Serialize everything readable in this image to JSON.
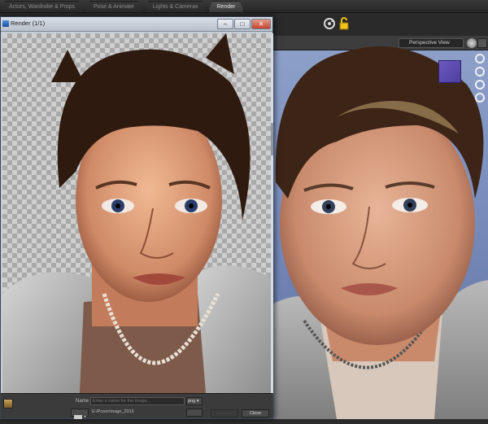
{
  "tabs": [
    {
      "label": "Actors, Wardrobe & Props",
      "active": false
    },
    {
      "label": "Pose & Animate",
      "active": false
    },
    {
      "label": "Lights & Cameras",
      "active": false
    },
    {
      "label": "Render",
      "active": true
    }
  ],
  "render_window": {
    "title": "Render (1/1)",
    "controls": {
      "minimize": "–",
      "maximize": "□",
      "close": "✕"
    },
    "footer": {
      "name_label": "Name",
      "name_placeholder": "Enter a name for the image...",
      "format": "png ▾",
      "path": "E:/PoserImage_2015",
      "save_label": "",
      "close_label": "Close"
    }
  },
  "viewport": {
    "view_select": "Perspective View"
  },
  "icons": {
    "app": "window-app-icon",
    "refresh": "refresh-icon",
    "lock": "lock-icon"
  },
  "colors": {
    "viewport_bg": "#7b8fbf",
    "lock": "#f2c21a"
  }
}
